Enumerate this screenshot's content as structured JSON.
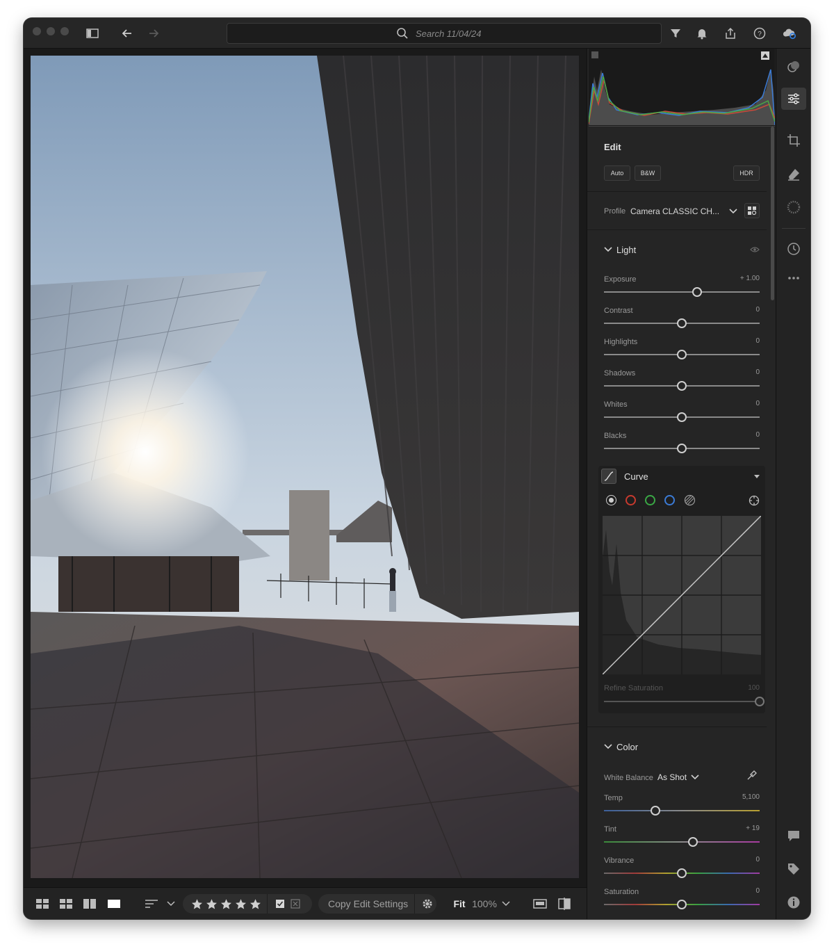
{
  "search": {
    "placeholder": "Search 11/04/24"
  },
  "edit": {
    "title": "Edit",
    "auto_label": "Auto",
    "bw_label": "B&W",
    "hdr_label": "HDR",
    "profile_label": "Profile",
    "profile_value": "Camera CLASSIC CH..."
  },
  "light": {
    "title": "Light",
    "sliders": [
      {
        "label": "Exposure",
        "value": "+ 1.00",
        "fraction": 0.6
      },
      {
        "label": "Contrast",
        "value": "0",
        "fraction": 0.5
      },
      {
        "label": "Highlights",
        "value": "0",
        "fraction": 0.5
      },
      {
        "label": "Shadows",
        "value": "0",
        "fraction": 0.5
      },
      {
        "label": "Whites",
        "value": "0",
        "fraction": 0.5
      },
      {
        "label": "Blacks",
        "value": "0",
        "fraction": 0.5
      }
    ]
  },
  "curve": {
    "title": "Curve",
    "refine_label": "Refine Saturation",
    "refine_value": "100",
    "refine_fraction": 1.0
  },
  "color": {
    "title": "Color",
    "wb_label": "White Balance",
    "wb_value": "As Shot",
    "sliders": [
      {
        "label": "Temp",
        "value": "5,100",
        "fraction": 0.33
      },
      {
        "label": "Tint",
        "value": "+ 19",
        "fraction": 0.57
      },
      {
        "label": "Vibrance",
        "value": "0",
        "fraction": 0.5
      },
      {
        "label": "Saturation",
        "value": "0",
        "fraction": 0.5
      }
    ]
  },
  "bottom": {
    "copy_label": "Copy Edit Settings",
    "fit_label": "Fit",
    "zoom_value": "100%",
    "stars": 5
  },
  "colors": {
    "accent": "#2f7de1",
    "panel_bg": "#252525"
  }
}
